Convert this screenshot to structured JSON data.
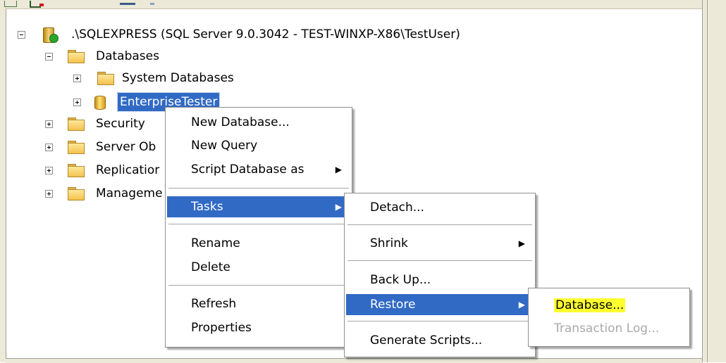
{
  "tree": {
    "server_label": ".\\SQLEXPRESS (SQL Server 9.0.3042 - TEST-WINXP-X86\\TestUser)",
    "databases_label": "Databases",
    "system_databases_label": "System Databases",
    "selected_db_label": "EnterpriseTester",
    "security_label": "Security",
    "server_objects_label": "Server Ob",
    "replication_label": "Replicatior",
    "management_label": "Manageme"
  },
  "context_menu": {
    "new_database": "New Database...",
    "new_query": "New Query",
    "script_database_as": "Script Database as",
    "tasks": "Tasks",
    "rename": "Rename",
    "delete": "Delete",
    "refresh": "Refresh",
    "properties": "Properties"
  },
  "tasks_menu": {
    "detach": "Detach...",
    "shrink": "Shrink",
    "back_up": "Back Up...",
    "restore": "Restore",
    "generate_scripts": "Generate Scripts..."
  },
  "restore_menu": {
    "database": "Database...",
    "transaction_log": "Transaction Log..."
  },
  "icons": {
    "submenu_arrow": "▶",
    "folder": "folder-icon",
    "database": "database-icon",
    "server": "server-icon"
  },
  "colors": {
    "selection": "#316ac5",
    "highlight_marker": "#ffff30",
    "disabled_text": "#a9a9a9"
  }
}
